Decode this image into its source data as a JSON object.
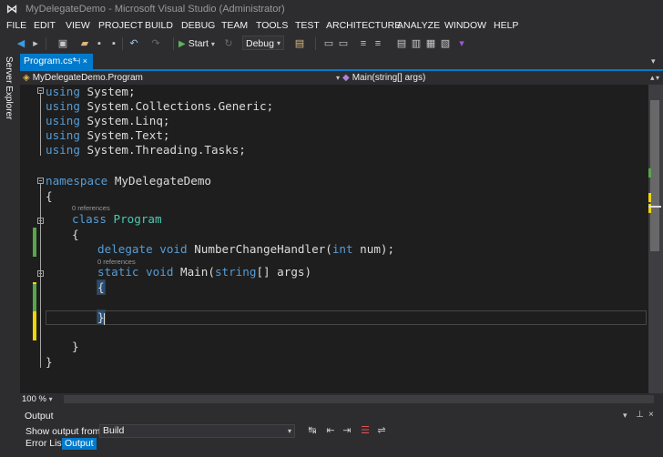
{
  "window": {
    "title": "MyDelegateDemo - Microsoft Visual Studio (Administrator)"
  },
  "menu": [
    "FILE",
    "EDIT",
    "VIEW",
    "PROJECT",
    "BUILD",
    "DEBUG",
    "TEAM",
    "TOOLS",
    "TEST",
    "ARCHITECTURE",
    "ANALYZE",
    "WINDOW",
    "HELP"
  ],
  "toolbar": {
    "start_label": "Start",
    "configuration": "Debug"
  },
  "side_panel": {
    "label": "Server Explorer"
  },
  "document": {
    "tab_label": "Program.cs*",
    "nav_left": "MyDelegateDemo.Program",
    "nav_right": "Main(string[] args)"
  },
  "code": {
    "lines": [
      [
        "using",
        " System;"
      ],
      [
        "using",
        " System.Collections.Generic;"
      ],
      [
        "using",
        " System.Linq;"
      ],
      [
        "using",
        " System.Text;"
      ],
      [
        "using",
        " System.Threading.Tasks;"
      ]
    ],
    "namespace_kw": "namespace",
    "namespace_name": " MyDelegateDemo",
    "open_brace": "{",
    "close_brace": "}",
    "codelens_class": "0 references",
    "class_kw": "class",
    "class_name": "Program",
    "delegate_kw": "delegate",
    "void_kw": "void",
    "delegate_name": " NumberChangeHandler(",
    "int_kw": "int",
    "delegate_tail": " num);",
    "codelens_method": "0 references",
    "static_kw": "static",
    "main_name": " Main(",
    "string_kw": "string",
    "main_tail": "[] args)"
  },
  "editor": {
    "zoom": "100 %"
  },
  "output": {
    "title": "Output",
    "show_from_label": "Show output from:",
    "source": "Build"
  },
  "bottom_tabs": [
    "Error List",
    "Output"
  ],
  "colors": {
    "accent": "#007acc",
    "keyword": "#569cd6",
    "type": "#4ec9b0",
    "change_saved": "#57a64a",
    "change_unsaved": "#efd501"
  }
}
